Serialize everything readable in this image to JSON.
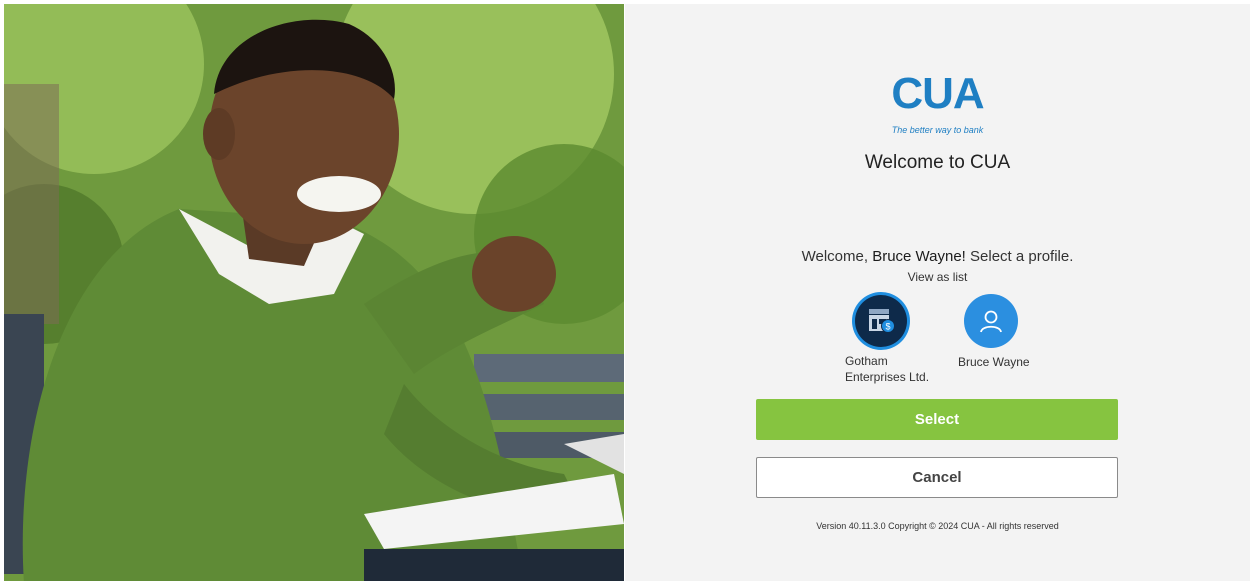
{
  "hero": {
    "alt": "Smiling man in green sweater using a laptop on a park bench"
  },
  "brand": {
    "logo_text": "CUA",
    "tagline": "The better way to bank",
    "primary_color": "#1f7fc3",
    "accent_color": "#86c440"
  },
  "login": {
    "title": "Welcome to CUA",
    "greeting_prefix": "Welcome,",
    "user_name": "Bruce Wayne!",
    "greeting_suffix": "Select a profile.",
    "view_as_list": "View as list",
    "profiles": [
      {
        "label_line1": "Gotham",
        "label_line2": "Enterprises Ltd.",
        "icon": "business-store-icon",
        "selected": true
      },
      {
        "label_line1": "Bruce Wayne",
        "label_line2": "",
        "icon": "person-icon",
        "selected": false
      }
    ],
    "select_label": "Select",
    "cancel_label": "Cancel",
    "footer": "Version 40.11.3.0 Copyright © 2024 CUA - All rights reserved"
  }
}
